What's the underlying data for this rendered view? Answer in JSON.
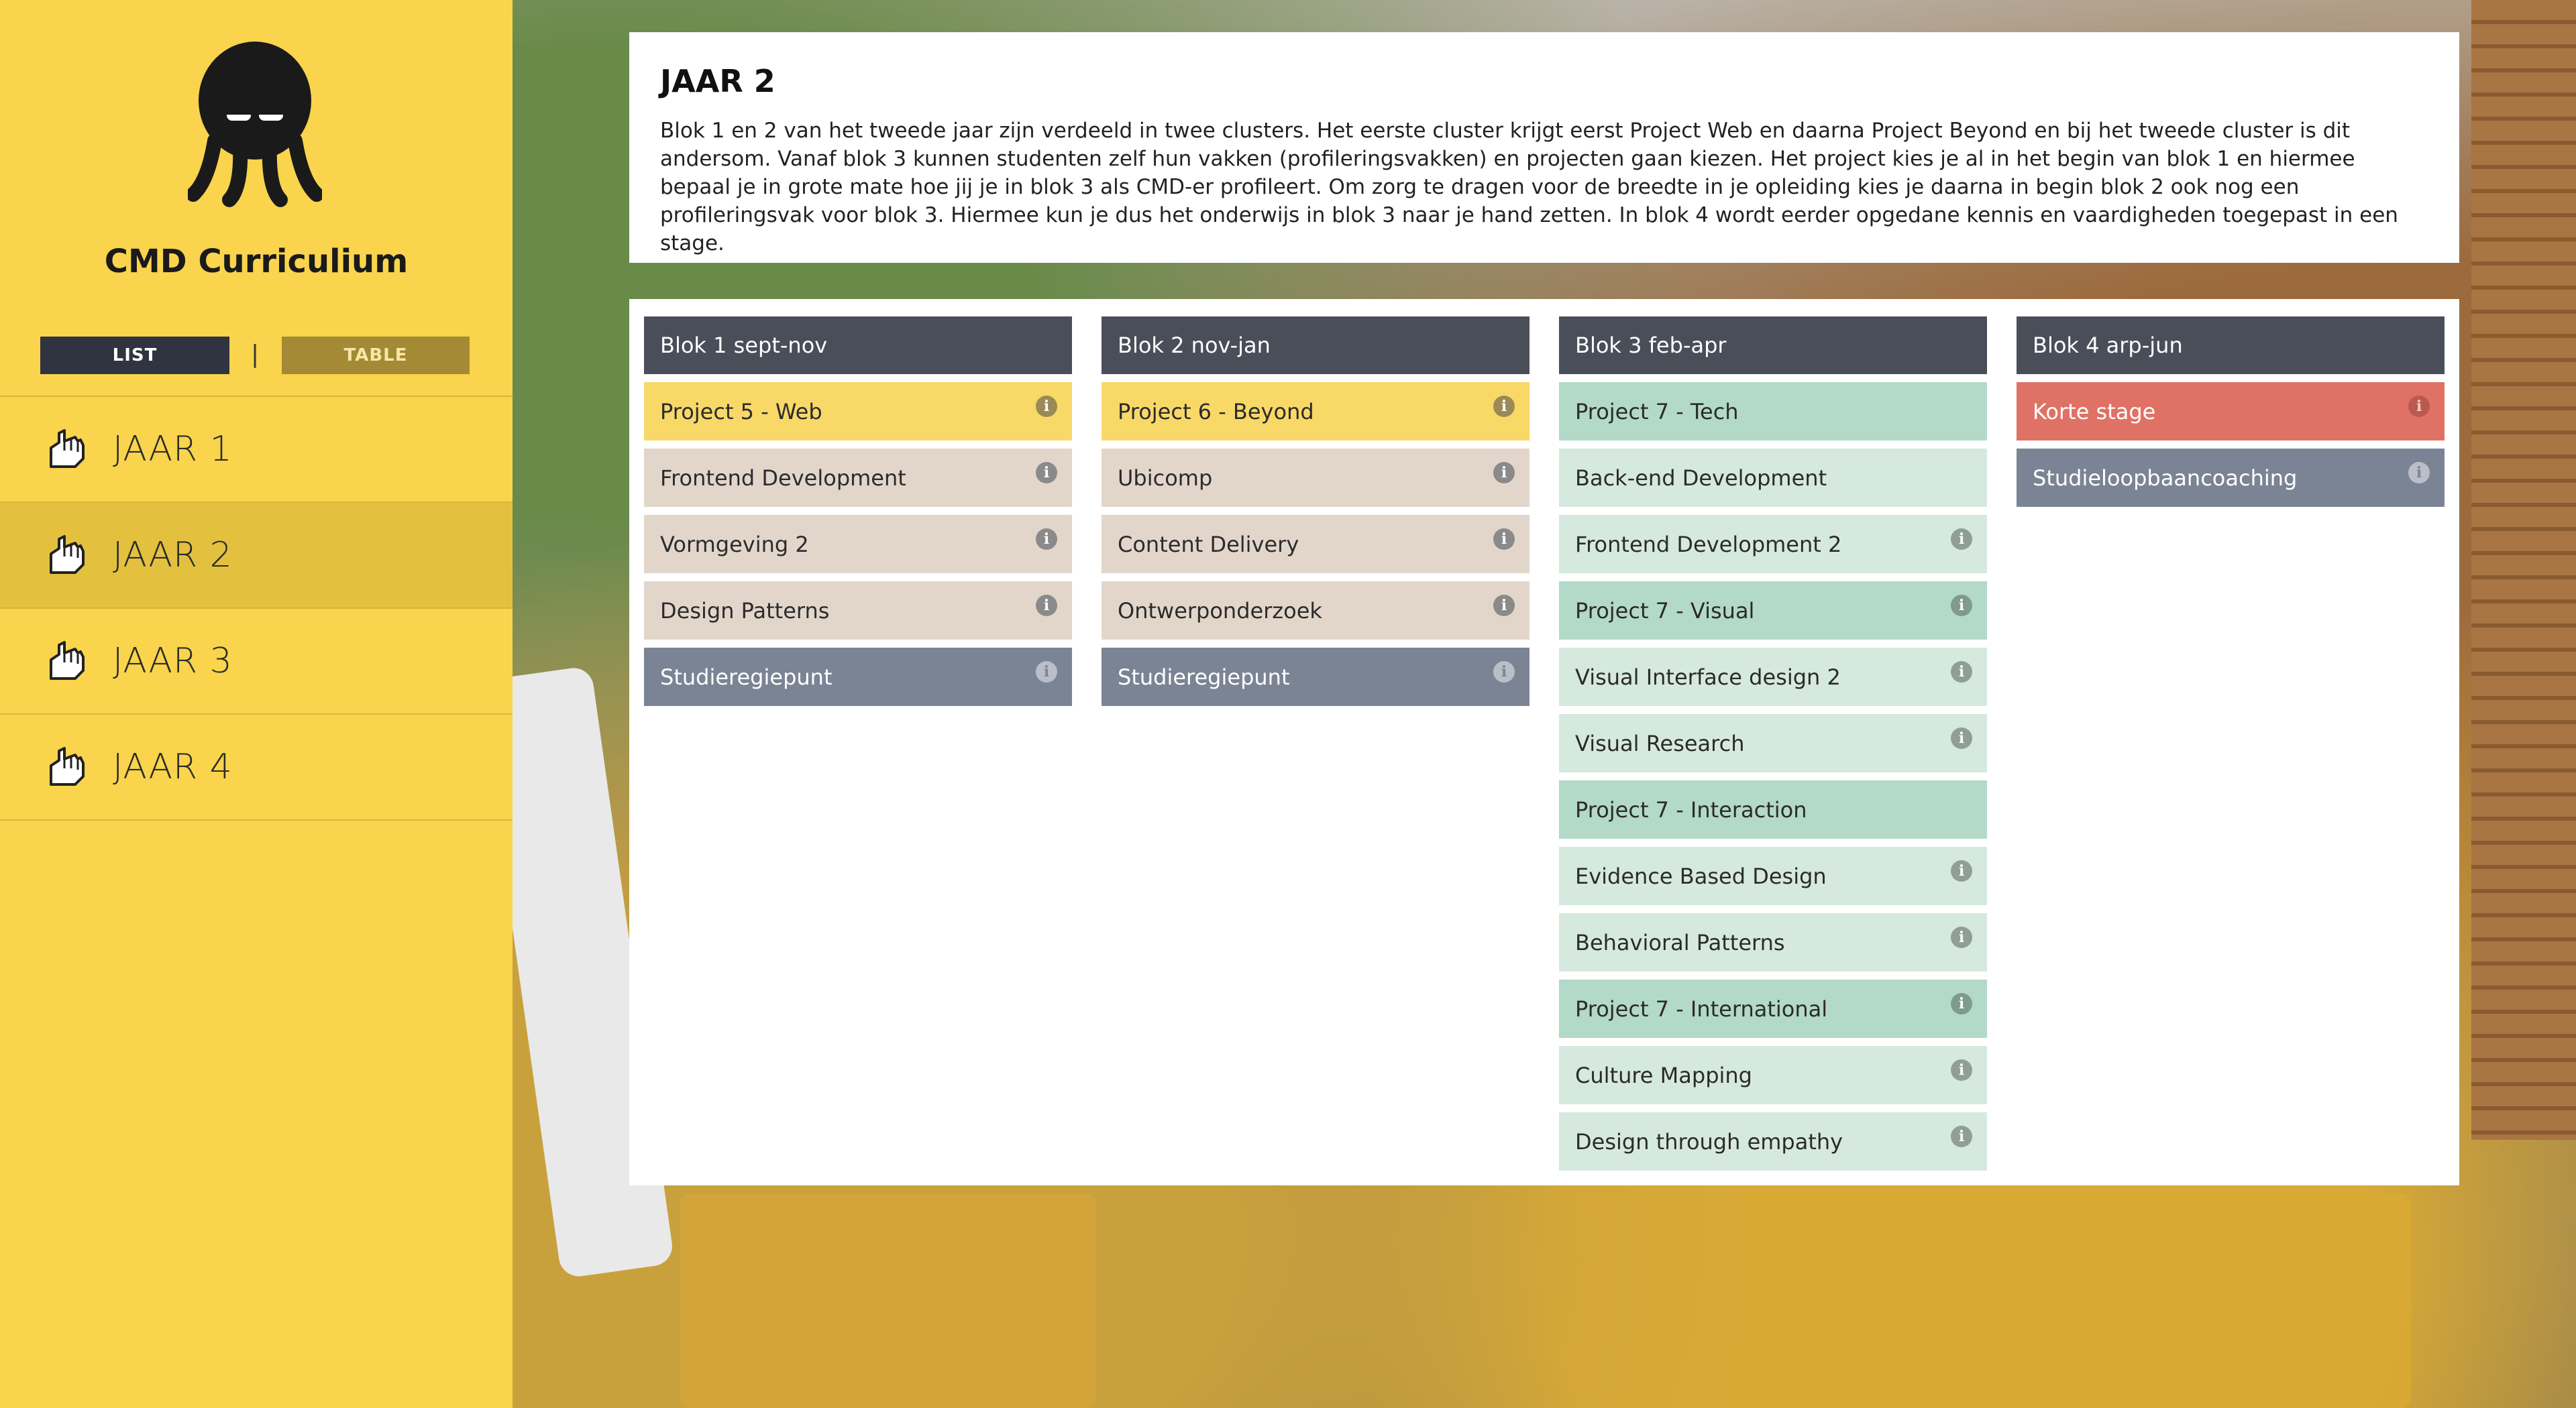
{
  "app": {
    "title": "CMD Curriculium"
  },
  "view_toggle": {
    "list_label": "LIST",
    "separator": "|",
    "table_label": "TABLE",
    "active": "LIST"
  },
  "nav": {
    "items": [
      {
        "label": "JAAR 1",
        "active": false
      },
      {
        "label": "JAAR 2",
        "active": true
      },
      {
        "label": "JAAR 3",
        "active": false
      },
      {
        "label": "JAAR 4",
        "active": false
      }
    ]
  },
  "intro": {
    "title": "JAAR 2",
    "text": "Blok 1 en 2 van het tweede jaar zijn verdeeld in twee clusters. Het eerste cluster krijgt eerst Project Web en daarna Project Beyond en bij het tweede cluster is dit andersom. Vanaf blok 3 kunnen studenten zelf hun vakken (profileringsvakken) en projecten gaan kiezen. Het project kies je al in het begin van blok 1 en hiermee bepaal je in grote mate hoe jij je in blok 3 als CMD-er profileert. Om zorg te dragen voor de breedte in je opleiding kies je daarna in begin blok 2 ook nog een profileringsvak voor blok 3. Hiermee kun je dus het onderwijs in blok 3 naar je hand zetten. In blok 4 wordt eerder opgedane kennis en vaardigheden toegepast in een stage."
  },
  "info_glyph": "i",
  "colors": {
    "sidebar": "#f9d44c",
    "header": "#4a4e59",
    "project": "#f8d867",
    "core": "#e2d6cb",
    "studie": "#7b8494",
    "mint_project": "#b3d9c8",
    "mint": "#d5e9df",
    "stage": "#e07165"
  },
  "blocks": [
    {
      "header": "Blok 1 sept-nov",
      "courses": [
        {
          "label": "Project 5 - Web",
          "type": "project",
          "info": true
        },
        {
          "label": "Frontend Development",
          "type": "core",
          "info": true
        },
        {
          "label": "Vormgeving 2",
          "type": "core",
          "info": true
        },
        {
          "label": "Design Patterns",
          "type": "core",
          "info": true
        },
        {
          "label": "Studieregiepunt",
          "type": "slb",
          "info": true
        }
      ]
    },
    {
      "header": "Blok 2 nov-jan",
      "courses": [
        {
          "label": "Project 6 - Beyond",
          "type": "project",
          "info": true
        },
        {
          "label": "Ubicomp",
          "type": "core",
          "info": true
        },
        {
          "label": "Content Delivery",
          "type": "core",
          "info": true
        },
        {
          "label": "Ontwerponderzoek",
          "type": "core",
          "info": true
        },
        {
          "label": "Studieregiepunt",
          "type": "slb",
          "info": true
        }
      ]
    },
    {
      "header": "Blok 3 feb-apr",
      "courses": [
        {
          "label": "Project 7 - Tech",
          "type": "pmint",
          "info": false
        },
        {
          "label": "Back-end Development",
          "type": "mint",
          "info": false
        },
        {
          "label": "Frontend Development 2",
          "type": "mint",
          "info": true
        },
        {
          "label": "Project 7 - Visual",
          "type": "pmint",
          "info": true
        },
        {
          "label": "Visual Interface design 2",
          "type": "mint",
          "info": true
        },
        {
          "label": "Visual Research",
          "type": "mint",
          "info": true
        },
        {
          "label": "Project 7 - Interaction",
          "type": "pmint",
          "info": false
        },
        {
          "label": "Evidence Based Design",
          "type": "mint",
          "info": true
        },
        {
          "label": "Behavioral Patterns",
          "type": "mint",
          "info": true
        },
        {
          "label": "Project 7 - International",
          "type": "pmint",
          "info": true
        },
        {
          "label": "Culture Mapping",
          "type": "mint",
          "info": true
        },
        {
          "label": "Design through empathy",
          "type": "mint",
          "info": true
        }
      ]
    },
    {
      "header": "Blok 4 arp-jun",
      "courses": [
        {
          "label": "Korte stage",
          "type": "stage",
          "info": true
        },
        {
          "label": "Studieloopbaancoaching",
          "type": "slb",
          "info": true
        }
      ]
    }
  ]
}
